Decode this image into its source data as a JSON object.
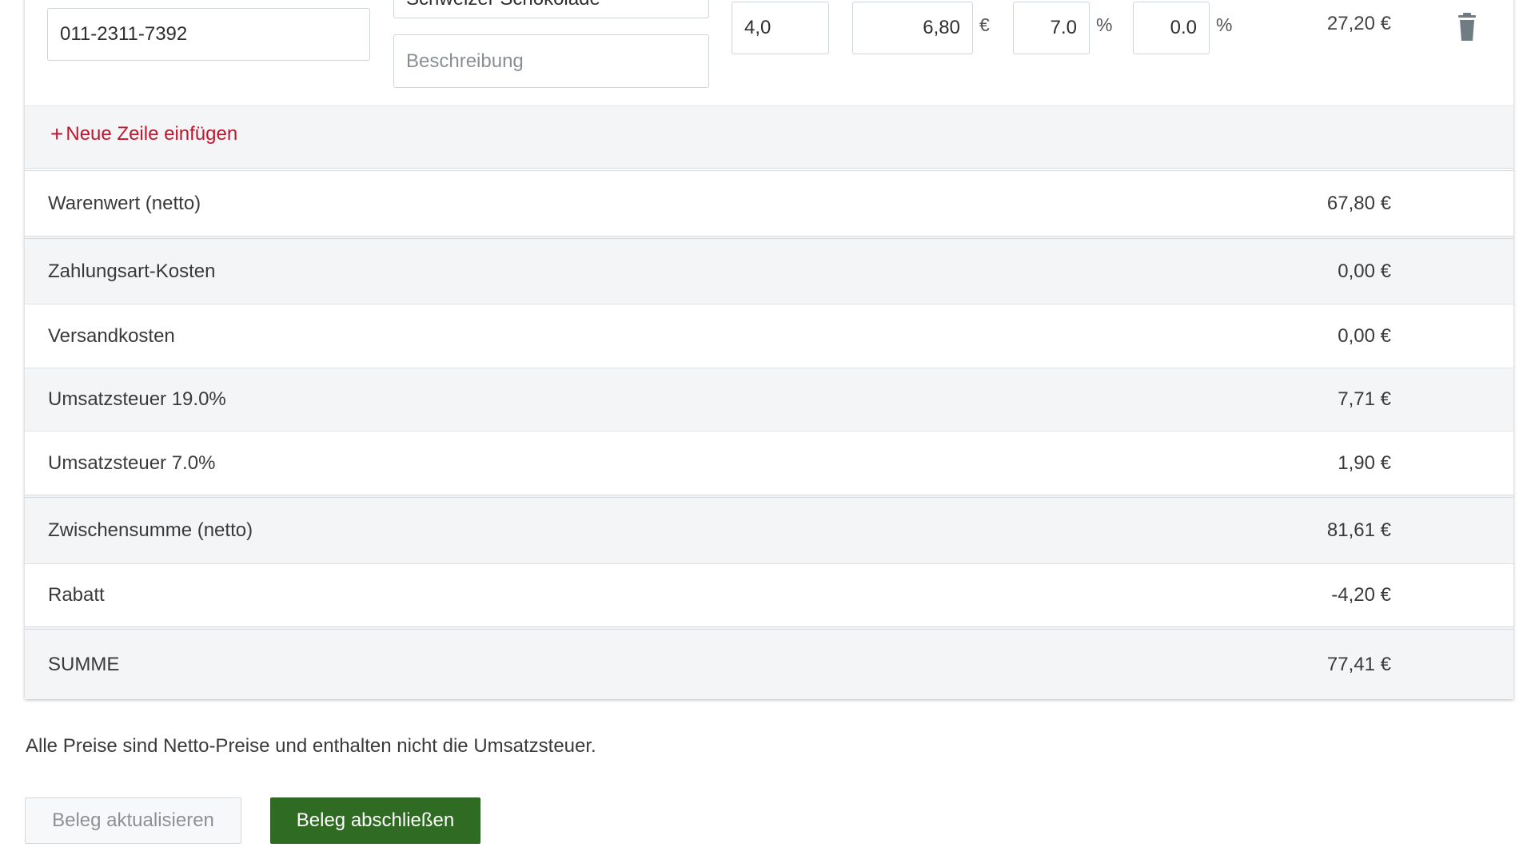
{
  "item": {
    "article_number": "011-2311-7392",
    "article_name": "Schweizer Schokolade",
    "description_placeholder": "Beschreibung",
    "quantity": "4,0",
    "unit_price": "6,80",
    "currency_symbol": "€",
    "tax_rate": "7.0",
    "discount": "0.0",
    "percent_symbol": "%",
    "line_total": "27,20 €"
  },
  "add_row_label": "Neue Zeile einfügen",
  "add_row_icon": "plus-icon",
  "delete_icon": "trash-icon",
  "summary": {
    "net_goods": {
      "label": "Warenwert (netto)",
      "value": "67,80 €"
    },
    "payment_costs": {
      "label": "Zahlungsart-Kosten",
      "value": "0,00 €"
    },
    "shipping": {
      "label": "Versandkosten",
      "value": "0,00 €"
    },
    "vat19": {
      "label": "Umsatzsteuer 19.0%",
      "value": "7,71 €"
    },
    "vat7": {
      "label": "Umsatzsteuer 7.0%",
      "value": "1,90 €"
    },
    "subtotal": {
      "label": "Zwischensumme (netto)",
      "value": "81,61 €"
    },
    "discount": {
      "label": "Rabatt",
      "value": "-4,20 €"
    },
    "total": {
      "label": "SUMME",
      "value": "77,41 €"
    }
  },
  "note": "Alle Preise sind Netto-Preise und enthalten nicht die Umsatzsteuer.",
  "buttons": {
    "update": "Beleg aktualisieren",
    "finish": "Beleg abschließen"
  },
  "colors": {
    "accent_link": "#c0172f",
    "primary_button": "#2f6b22",
    "row_shade": "#f3f5f6",
    "icon_gray": "#6f7c83"
  }
}
